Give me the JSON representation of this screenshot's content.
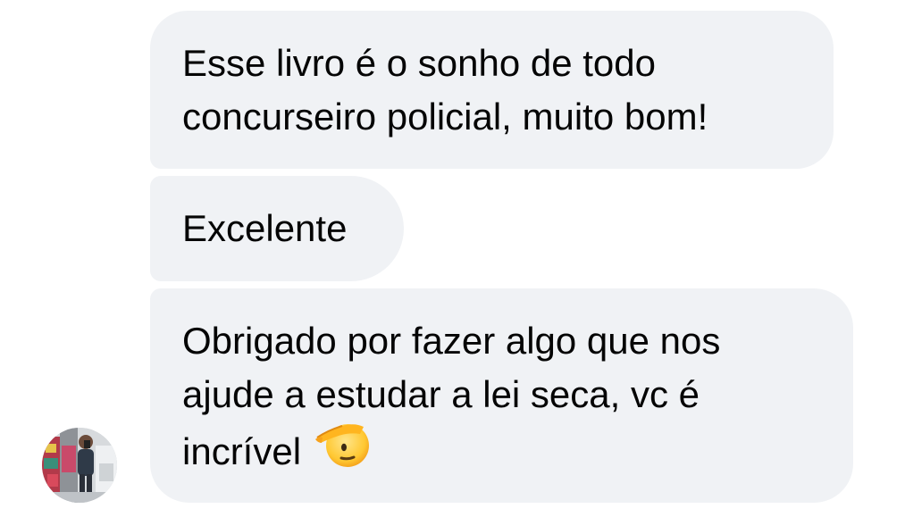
{
  "messages": [
    {
      "line1": "Esse livro é o sonho de todo",
      "line2": "concurseiro policial, muito bom!"
    },
    {
      "line1": "Excelente"
    },
    {
      "line1": "Obrigado por fazer algo que nos",
      "line2": "ajude a estudar a lei seca, vc é",
      "line3": "incrível",
      "emoji": "saluting-face-icon"
    }
  ],
  "colors": {
    "bubble_background": "#f0f2f5",
    "text": "#050505"
  }
}
